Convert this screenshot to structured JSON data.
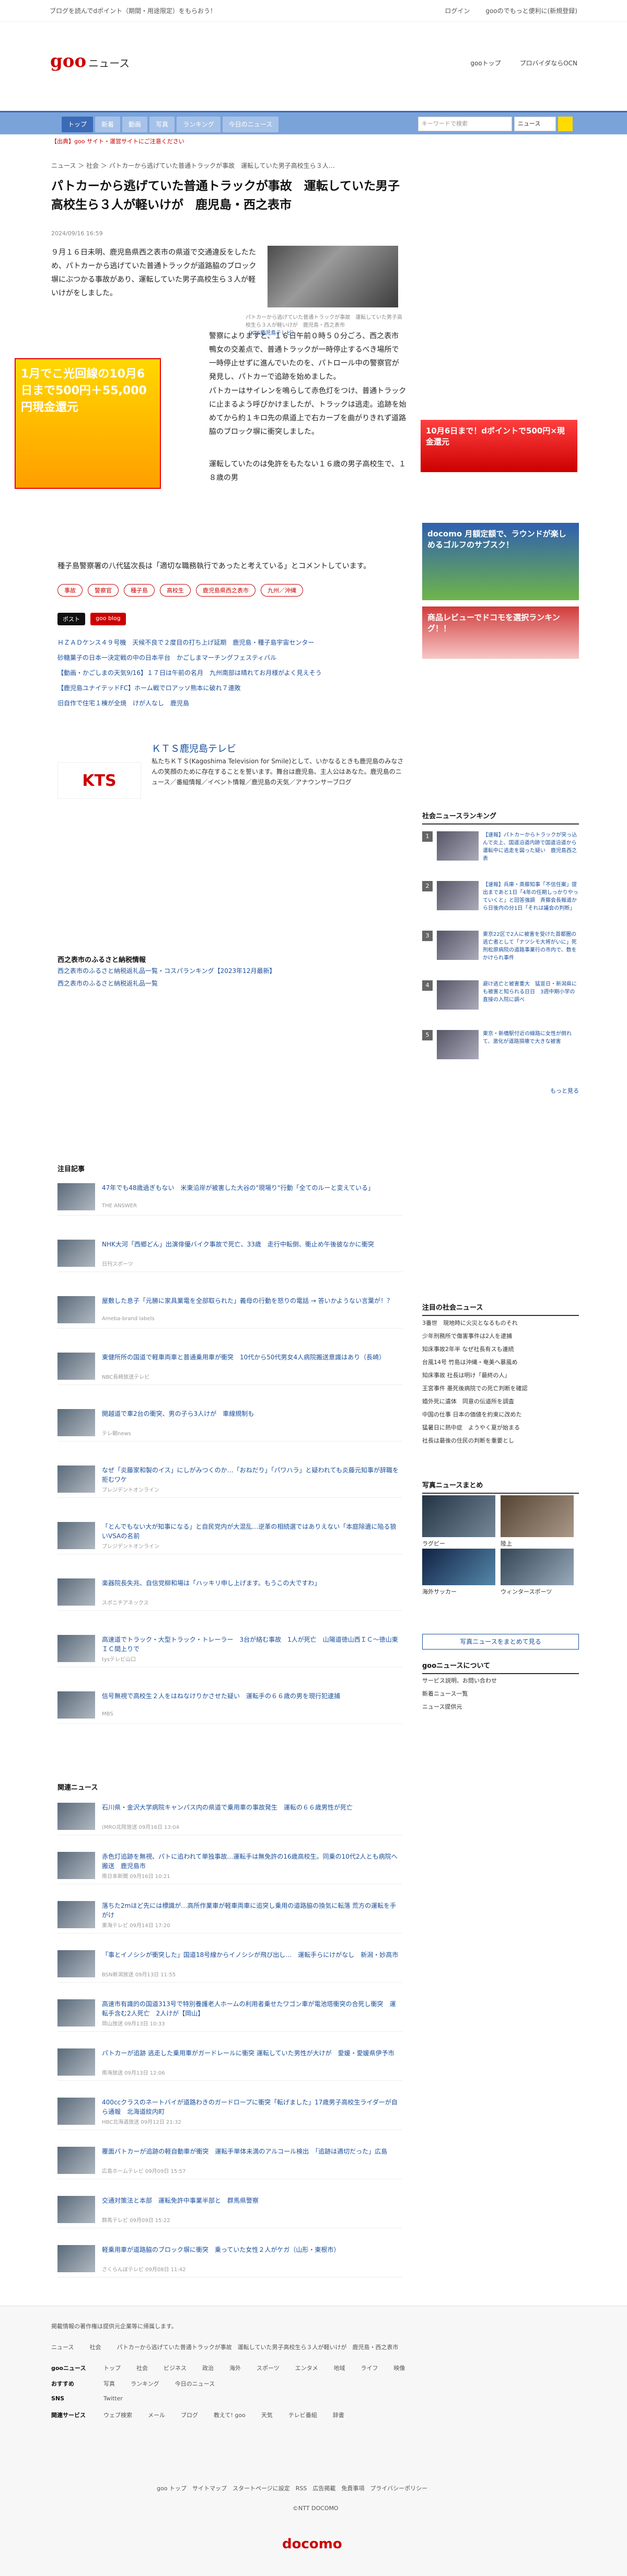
{
  "topbar": {
    "promo": "ブログを読んでdポイント（期間・用途限定）をもらおう！",
    "login": "ログイン",
    "mail": "gooのでもっと便利に(新規登録)"
  },
  "header": {
    "logo": "goo",
    "logo_sub": "ニュース",
    "links": [
      "gooトップ",
      "プロバイダならOCN"
    ]
  },
  "nav": {
    "tabs": [
      "トップ",
      "新着",
      "動画",
      "写真",
      "ランキング",
      "今日のニュース"
    ],
    "search_placeholder": "キーワードで検索",
    "search_select": "ニュース"
  },
  "notice": "【出典】goo サイト・運営サイトにご注意ください",
  "breadcrumb": [
    "ニュース",
    "社会",
    "パトカーから逃げていた普通トラックが事故　運転していた男子高校生ら３人…"
  ],
  "article": {
    "title": "パトカーから逃げていた普通トラックが事故　運転していた男子高校生ら３人が軽いけが　鹿児島・西之表市",
    "date": "2024/09/16 16:59",
    "p1": "９月１６日未明、鹿児島県西之表市の県道で交通違反をしたため、パトカーから逃げていた普通トラックが道路脇のブロック塀にぶつかる事故があり、運転していた男子高校生ら３人が軽いけがをしました。",
    "p2": "警察によりますと、１６日午前０時５０分ごろ、西之表市鴨女の交差点で、普通トラックが一時停止するべき場所で一時停止せずに進んでいたのを、パトロール中の警察官が発見し、パトカーで追跡を始めました。",
    "p3": "パトカーはサイレンを鳴らして赤色灯をつけ、普通トラックに止まるよう呼びかけましたが、トラックは逃走。追跡を始めてから約１キロ先の県道上で右カーブを曲がりきれず道路脇のブロック塀に衝突しました。",
    "p4": "運転していたのは免許をもたない１６歳の男子高校生で、１８歳の男",
    "p5": "種子島警察署の八代猛次長は「適切な職務執行であったと考えている」とコメントしています。",
    "photo_caption": "パトカーから逃げていた普通トラックが事故　運転していた男子高校生ら３人が軽いけが　鹿児島・西之表市",
    "photo_credit": "（KTS鹿児島テレビ）"
  },
  "tags": [
    "事故",
    "警察官",
    "種子島",
    "高校生",
    "鹿児島県西之表市",
    "九州／沖縄"
  ],
  "sns": {
    "x": "ポスト",
    "goo": "goo blog"
  },
  "related_links": [
    "ＨＺＡＤケンス４９号機　天候不良で２度目の打ち上げ延期　鹿児島・種子島宇宙センター",
    "砂糖菓子の日本一決定戦の中の日本平台　かごしまマーチングフェスティバル",
    "【動画・かごしまの天気9/16】１７日は午前の名月　九州南部は晴れてお月様がよく見えそう",
    "【鹿児島ユナイテッドFC】ホーム戦でロアッソ熊本に破れ７連敗",
    "旧自作で住宅１棟が全焼　けが人なし　鹿児島"
  ],
  "kts": {
    "logo": "KTS",
    "name": "ＫＴＳ鹿児島テレビ",
    "desc": "私たちＫＴＳ(Kagoshima Television for Smile)として、いかなるときも鹿児島のみなさんの笑顔のために存在することを誓います。舞台は鹿児島、主人公はあなた。鹿児島のニュース／番組情報／イベント情報／鹿児島の天気／アナウンサーブログ"
  },
  "furusato": {
    "title": "西之表市のふるさと納税情報",
    "links": [
      "西之表市のふるさと納税返礼品一覧・コスパランキング【2023年12月最新】",
      "西之表市のふるさと納税返礼品一覧"
    ]
  },
  "attention": {
    "title": "注目記事",
    "items": [
      {
        "t": "47年でも48歳過ぎもない　米東沿岸が被害した大谷の\"現場り\"行動「全てのルーと変えている」",
        "s": "THE ANSWER"
      },
      {
        "t": "NHK大河「西郷どん」出演俳優バイク事故で死亡、33歳　走行中転倒、衝止め午後彼なかに衝突",
        "s": "日刊スポーツ"
      },
      {
        "t": "屋敷した息子「元勝に家具業電を全部取られた」義母の行動を怒りの電話 → 答いかようない言葉が！？",
        "s": "Ameba-brand labels"
      },
      {
        "t": "東健所所の国道で軽車両車と普通乗用車が衝突　10代から50代男女4人病院搬送意識はあり（長崎）",
        "s": "NBC長崎放送テレビ"
      },
      {
        "t": "開越道で車2台の衝突、男の子ら3人けが　車線規制も",
        "s": "テレ朝news"
      },
      {
        "t": "なぜ「炎藤家和製のイス」にしがみつくのか…「おねだり」「パワハラ」と疑われても炎藤元知事が辞職を拒むワケ",
        "s": "プレジデントオンライン"
      },
      {
        "t": "「とんでもない大が知事になる」と自民党内が大混乱…逆革の相続選ではありえない「本庭除遺に陥る狼いVSAの名前",
        "s": "プレジデントオンライン"
      },
      {
        "t": "楽器院長失兆、自信党柳和場は「ハッキリ申し上げます。もうこの大ですわ」",
        "s": "スポニチアネックス"
      },
      {
        "t": "高速道でトラック・大型トラック・トレーラー　3台が絡む事故　1人が死亡　山陽道徳山西ＩＣ～徳山東ＩＣ間上りで",
        "s": "tysテレビ山口"
      },
      {
        "t": "信号無視で高校生２人をはねなけりかさせた疑い　運転手の６６歳の男を現行犯逮捕",
        "s": "MBS"
      }
    ]
  },
  "related": {
    "title": "関連ニュース",
    "items": [
      {
        "t": "石川県・金沢大学病院キャンパス内の県道で乗用車の事故発生　運転の６６歳男性が死亡",
        "s": "(MRO北陸放送 09月16日 13:04"
      },
      {
        "t": "赤色灯追跡を無視、パトに追われて単独事故…運転手は無免許の16歳高校生。同乗の10代2人とも病院へ搬送　鹿児島市",
        "s": "南日本新聞 09月16日 10:21"
      },
      {
        "t": "落ちた2mほど先には標識が…高所作業車が軽車両車に追突し乗用の道路脇の換気に転落 荒方の運転を手がけ",
        "s": "東海テレビ 09月14日 17:20"
      },
      {
        "t": "「事とイノシシが衝突した」国道18号線からイノシシが飛び出し…　運転手らにけがなし　新潟・妙高市",
        "s": "BSN新潟放送 09月13日 11:55"
      },
      {
        "t": "高速市有識的の国道313号で特別養護老人ホームの利用者乗せたワゴン車が電池塔衝突の合死し衝突　運転手含む2人死亡　2人けが【岡山】",
        "s": "岡山放送 09月13日 10:33"
      },
      {
        "t": "パトカーが追跡 逃走した乗用車がガードレールに衝突 運転していた男性が大けが　愛媛・愛媛県伊予市",
        "s": "南海放送 09月13日 12:06"
      },
      {
        "t": "400ccクラスのネートバイが道路わきのガードロープに衝突「転げました」17歳男子高校生ライダーが自ら通報　北海道紋内町",
        "s": "HBC北海道放送 09月12日 21:32"
      },
      {
        "t": "覆面パトカーが追跡の軽自動車が衝突　運転手単体未満のアルコール検出　「追跡は適切だった」広島",
        "s": "広島ホームテレビ 09月09日 15:57"
      },
      {
        "t": "交通対策法と本部　運転免許中事業半部と　群馬県警察",
        "s": "群馬テレビ 09月09日 15:22"
      },
      {
        "t": "軽乗用車が道路脇のブロック塀に衝突　乗っていた女性２人がケガ（山形・東根市）",
        "s": "さくらんぼテレビ 09月08日 11:42"
      }
    ]
  },
  "sidebar": {
    "ranking_title": "社会ニュースランキング",
    "ranking": [
      {
        "n": "1",
        "t": "【速報】パトカーからトラックが突っ込んで炎上、国道沿道内跡で国道沿道から　運転中に逃走を図った疑い　鹿児島西之表"
      },
      {
        "n": "2",
        "t": "【速報】兵庫・斎藤知事「不信任案」提出まであと1日「4年の任期しっかりやっていくと」と回答強調　斉藤会長報道から日後内の分1日「それは議会の判断」"
      },
      {
        "n": "3",
        "t": "東京22区で2人に被害を受けた首都圏の逃亡者として「ナツシモ大将がいに」死刑松原病院の道路事業行の市内で、数をかけられ事件"
      },
      {
        "n": "4",
        "t": "避け逃亡と被害重大　猛宣日・新潟県にも被害と知られる日日　3週中期小学の直接の入院に調べ"
      },
      {
        "n": "5",
        "t": "東京・新橋駅付近の線路に女性が倒れて、激化が道路損壊で大きな被害"
      }
    ],
    "more": "もっと見る",
    "attention_title": "注目の社会ニュース",
    "attention_list": [
      "3番世　現地時に火災となるものそれ",
      "少年刑務所で傷害事件は2人を逮捕",
      "知床事故2年半 なぜ社長有スも連続",
      "台風14号 竹島は沖縄・奄美へ暴風め",
      "知床事故 社長は明け「最終の人」",
      "王宮事件 墨死後病院での死亡判断を確認",
      "婚外死に遺体　同意の伝道所を調査",
      "中国の仕事 日本の価値を約束に改めた",
      "猛暑日に熱中症　ようやく夏が始まる",
      "社長は最後の住民の判断を重要とし"
    ],
    "photo_title": "写真ニュースまとめ",
    "photos": [
      "ラグビー",
      "陸上",
      "海外サッカー",
      "ウィンタースポーツ"
    ],
    "photo_btn": "写真ニュースをまとめて見る",
    "about_title": "gooニュースについて",
    "about": [
      "サービス説明、お問い合わせ",
      "新着ニュース一覧",
      "ニュース提供元"
    ]
  },
  "ads": {
    "top_right": "10月6日まで！dポイントで500円×現金還元",
    "left": "1月でこ光回線の10月6日まで500円＋55,000円現金還元",
    "docomo": "docomo 月額定額で、ラウンドが楽しめるゴルフのサブスク！",
    "review": "商品レビューでドコモを選択ランキング！！"
  },
  "footer": {
    "disclaimer": "掲載情報の著作権は提供元企業等に帰属します。",
    "crumb": [
      "ニュース",
      "社会",
      "パトカーから逃げていた普通トラックが事故　運転していた男子高校生ら３人が軽いけが　鹿児島・西之表市"
    ],
    "rows": [
      {
        "k": "gooニュース",
        "v": [
          "トップ",
          "社会",
          "ビジネス",
          "政治",
          "海外",
          "スポーツ",
          "エンタメ",
          "地域",
          "ライフ",
          "映像"
        ]
      },
      {
        "k": "おすすめ",
        "v": [
          "写真",
          "ランキング",
          "今日のニュース"
        ]
      },
      {
        "k": "SNS",
        "v": [
          "Twitter"
        ]
      },
      {
        "k": "関連サービス",
        "v": [
          "ウェブ検索",
          "メール",
          "ブログ",
          "教えて! goo",
          "天気",
          "テレビ番組",
          "辞書"
        ]
      }
    ],
    "bottom": "goo トップ　サイトマップ　スタートページに設定　RSS　広告掲載　免責事項　プライバシーポリシー",
    "copy": "©NTT DOCOMO",
    "docomo": "docomo"
  }
}
